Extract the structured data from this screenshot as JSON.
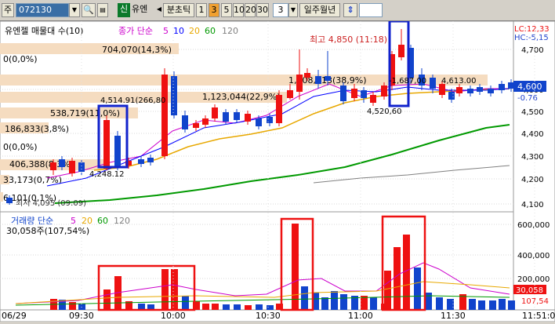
{
  "toolbar": {
    "mode_label": "주",
    "code": "072130",
    "name_badge": "신",
    "name": "유엔",
    "period_tick": "분초틱",
    "intervals": [
      "1",
      "3",
      "5",
      "10",
      "20",
      "30"
    ],
    "active_interval": "3",
    "count_value": "3",
    "period_labels": "일주월년",
    "extra_icon": "sort-icon"
  },
  "price_panel": {
    "title": "유엔젤 매물대 수(10)",
    "ma_legend_label": "종가 단순",
    "ma_periods": [
      {
        "label": "5",
        "color": "#cc00cc"
      },
      {
        "label": "10",
        "color": "#0000ff"
      },
      {
        "label": "20",
        "color": "#e8a800"
      },
      {
        "label": "60",
        "color": "#009900"
      },
      {
        "label": "120",
        "color": "#808080"
      }
    ],
    "lc_label": "LC:12,33",
    "hc_label": "HC:-5,15",
    "current_price": "4,600",
    "change_pct": "-0.76",
    "y_ticks": [
      "4,700",
      "4,600",
      "4,500",
      "4,400",
      "4,300",
      "4,200",
      "4,100"
    ],
    "high_label": "최고 4,850 (11:18)",
    "low_label": "최저 4,095 (09:09)",
    "annotations": [
      "4,514.91(266,80",
      "4,248.12",
      "4,520,60",
      "4,613.00"
    ],
    "volume_profile": [
      {
        "label": "0(0,0%)"
      },
      {
        "label": "704,070(14,3%)"
      },
      {
        "label": "1,908,913(38,9%)"
      },
      {
        "label": "1,123,044(22,9%)"
      },
      {
        "label": "538,719(11,0%)"
      },
      {
        "label": "186,833(3,8%)"
      },
      {
        "label": "0(0,0%)"
      },
      {
        "label": "406,388(8,3%)"
      },
      {
        "label": "33,173(0,7%)"
      },
      {
        "label": "6,101(0,1%)"
      }
    ],
    "extra_labels": [
      "-1,687,00"
    ]
  },
  "volume_panel": {
    "title": "거래량 단순",
    "ma_periods": [
      {
        "label": "5",
        "color": "#cc00cc"
      },
      {
        "label": "20",
        "color": "#e8a800"
      },
      {
        "label": "60",
        "color": "#009900"
      },
      {
        "label": "120",
        "color": "#808080"
      }
    ],
    "summary": "30,058주(107,54%)",
    "y_ticks": [
      "600,000",
      "400,000",
      "200,000"
    ],
    "current_value": "30,058",
    "current_pct": "107,54"
  },
  "x_axis": {
    "date_label": "06/29",
    "time_labels": [
      "09:30",
      "10:00",
      "10:30",
      "11:00",
      "11:30",
      "11:51:0"
    ]
  },
  "colors": {
    "up": "#ee1111",
    "down": "#1144cc",
    "highlight_box_red": "#ee1111",
    "highlight_box_blue": "#1122cc",
    "profile_fill": "#f5dcc0"
  }
}
